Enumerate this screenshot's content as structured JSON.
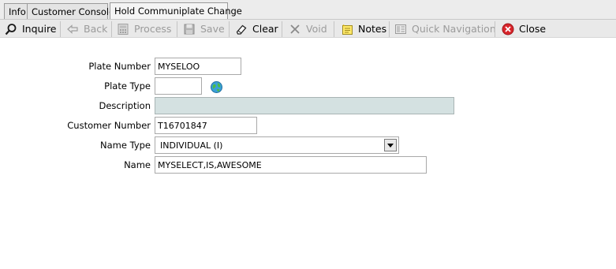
{
  "tabs": [
    {
      "label": "Info"
    },
    {
      "label": "Customer Console"
    },
    {
      "label": "Hold Communiplate Change"
    }
  ],
  "toolbar": {
    "inquire": "Inquire",
    "back": "Back",
    "process": "Process",
    "save": "Save",
    "clear": "Clear",
    "void": "Void",
    "notes": "Notes",
    "quick_navigation": "Quick Navigation",
    "close": "Close"
  },
  "form": {
    "plate_number": {
      "label": "Plate Number",
      "value": "MYSELOO"
    },
    "plate_type": {
      "label": "Plate Type",
      "value": ""
    },
    "description": {
      "label": "Description",
      "value": ""
    },
    "customer_number": {
      "label": "Customer Number",
      "value": "T16701847"
    },
    "name_type": {
      "label": "Name Type",
      "value": "INDIVIDUAL (I)"
    },
    "name": {
      "label": "Name",
      "value": "MYSELECT,IS,AWESOME"
    }
  },
  "colors": {
    "disabled_field": "#d4e1e1",
    "close_icon": "#d9262c",
    "toolbar_bg": "#e9e9e9"
  }
}
